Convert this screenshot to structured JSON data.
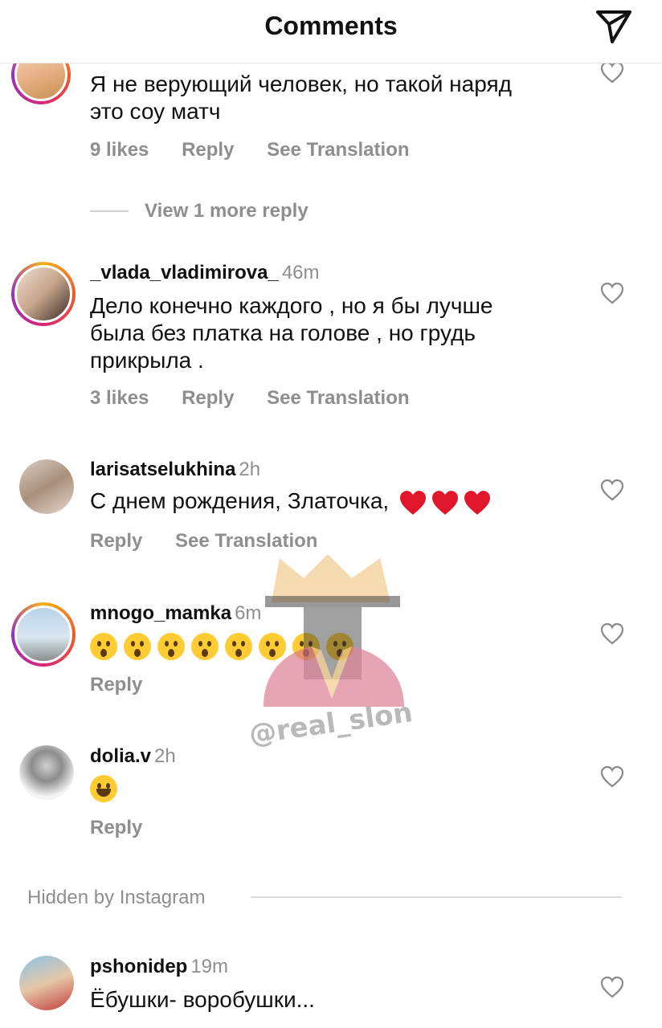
{
  "header": {
    "title": "Comments",
    "send_icon": "paper-plane-icon"
  },
  "comments": [
    {
      "username": "",
      "time": "",
      "text_lines": [
        "Я не верующий человек, но такой наряд",
        "это соу матч"
      ],
      "likes": "9 likes",
      "reply": "Reply",
      "translation": "See Translation"
    },
    {
      "username": "_vlada_vladimirova_",
      "time": "46m",
      "text_lines": [
        "Дело конечно каждого , но я бы лучше",
        "была без платка на голове , но грудь",
        "прикрыла ."
      ],
      "likes": "3 likes",
      "reply": "Reply",
      "translation": "See Translation"
    },
    {
      "username": "larisatselukhina",
      "time": "2h",
      "text": "С днем рождения, Златочка,",
      "reply": "Reply",
      "translation": "See Translation"
    },
    {
      "username": "mnogo_mamka",
      "time": "6m",
      "reply": "Reply"
    },
    {
      "username": "dolia.v",
      "time": "2h",
      "reply": "Reply"
    },
    {
      "username": "pshonidep",
      "time": "19m",
      "text": "Ёбушки- воробушки..."
    }
  ],
  "view_more": "View 1 more reply",
  "hidden_by": "Hidden by Instagram",
  "watermark": "@real_slon",
  "colors": {
    "secondary_text": "#8e8e8e",
    "heart_emoji": "#e0162b",
    "emoji_yellow": "#ffcc33"
  }
}
